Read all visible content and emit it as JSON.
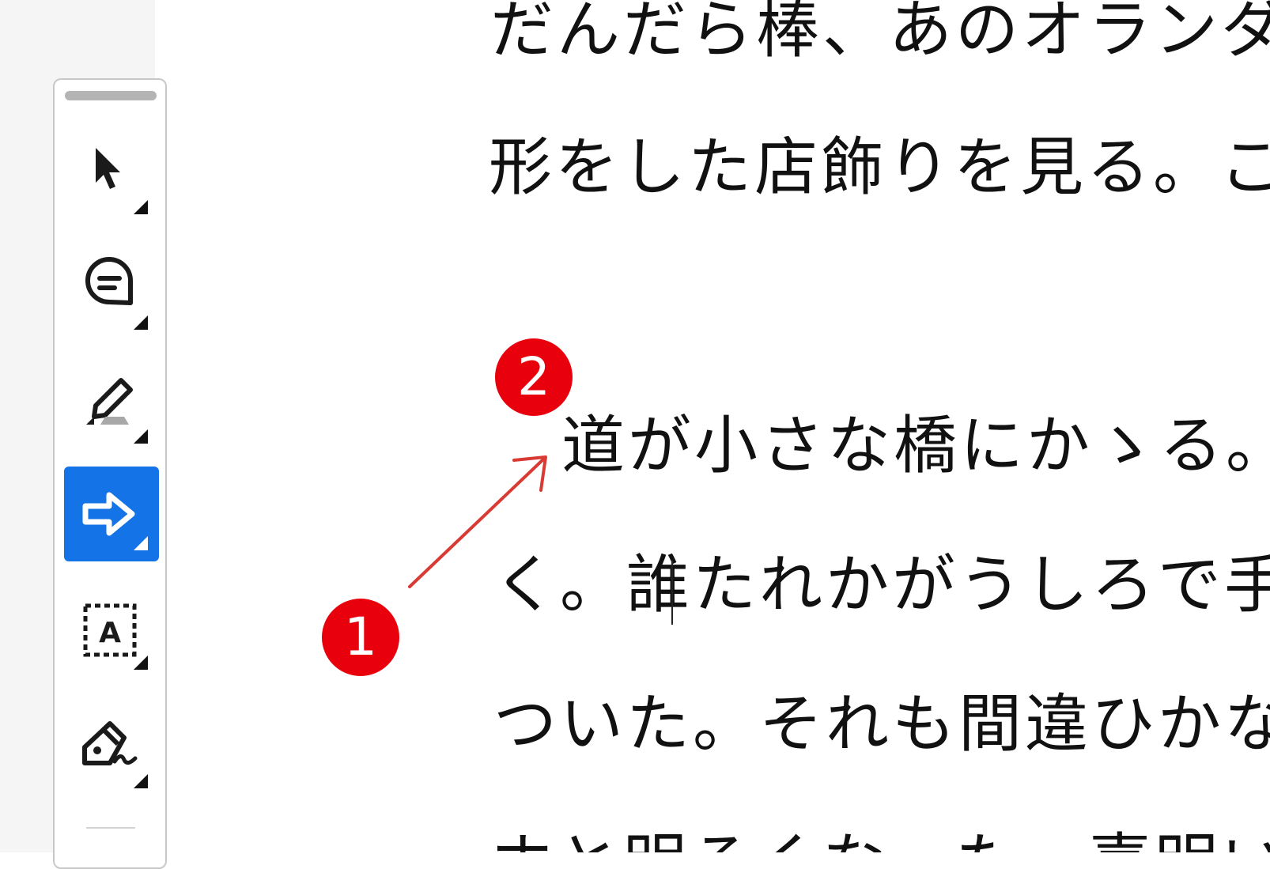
{
  "toolbar": {
    "tools": [
      {
        "name": "select-tool",
        "icon": "cursor-arrow-icon",
        "active": false
      },
      {
        "name": "comment-tool",
        "icon": "speech-bubble-icon",
        "active": false
      },
      {
        "name": "highlight-tool",
        "icon": "highlighter-pen-icon",
        "active": false
      },
      {
        "name": "arrow-tool",
        "icon": "right-arrow-icon",
        "active": true
      },
      {
        "name": "text-box-tool",
        "icon": "text-box-icon",
        "label": "A",
        "active": false
      },
      {
        "name": "sign-tool",
        "icon": "fountain-pen-sign-icon",
        "active": false
      }
    ]
  },
  "document": {
    "lines": [
      "だんだら棒、あのオランダ",
      "形をした店飾りを見る。こ",
      "道が小さな橋にかゝる。",
      "く。誰たれかがうしろで手",
      "ついた。それも間違ひかな",
      "ホと明るくなった。喜明い"
    ]
  },
  "annotations": {
    "badge_1": "1",
    "badge_2": "2",
    "arrow_color": "#d93a33",
    "badge_color": "#e8000d"
  },
  "colors": {
    "accent": "#1473e6",
    "toolbar_border": "#c8c8c8",
    "gutter": "#f5f5f5"
  }
}
